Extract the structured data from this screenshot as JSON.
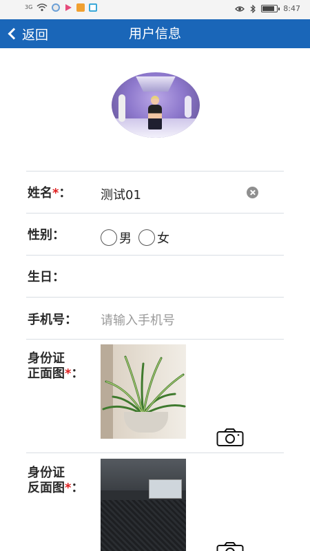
{
  "status_bar": {
    "signal": "3G",
    "time": "8:47",
    "battery_level": 0.75
  },
  "header": {
    "back_label": "返回",
    "title": "用户信息"
  },
  "form": {
    "name": {
      "label": "姓名",
      "required_mark": "*",
      "suffix": "：",
      "value": "测试01"
    },
    "gender": {
      "label": "性别：",
      "options": [
        "男",
        "女"
      ]
    },
    "birthday": {
      "label": "生日："
    },
    "phone": {
      "label": "手机号：",
      "placeholder": "请输入手机号"
    },
    "id_front": {
      "label_line1": "身份证",
      "label_line2": "正面图",
      "required_mark": "*",
      "suffix": "："
    },
    "id_back": {
      "label_line1": "身份证",
      "label_line2": "反面图",
      "required_mark": "*",
      "suffix": "："
    }
  },
  "colors": {
    "header_bg": "#1a66b8",
    "required": "#e02020",
    "divider": "#d8dde3"
  }
}
